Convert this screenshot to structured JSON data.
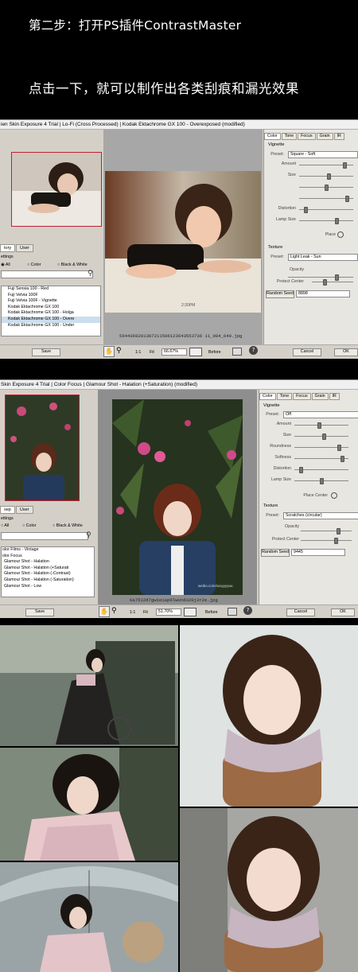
{
  "header": {
    "step_title": "第二步：打开PS插件ContrastMaster",
    "instruction": "点击一下，就可以制作出各类刮痕和漏光效果"
  },
  "window1": {
    "title": "ien Skin Exposure 4 Trial | Lo-Fi (Cross Processed) | Kodak Ektachrome GX 100 - Overexposed (modified)",
    "tabs": [
      "tory",
      "User"
    ],
    "settings_label": "ettings",
    "radios": [
      "All",
      "Color",
      "Black & White"
    ],
    "presets": [
      "Fuji Sensia 100 - Red",
      "Fuji Velvia 100F",
      "Fuji Velvia 100F - Vignette",
      "Kodak Ektachrome GX 100",
      "Kodak Ektachrome GX 100 - Holga",
      "Kodak Ektachrome GX 100 - Overe",
      "Kodak Ektachrome GX 100 - Under"
    ],
    "filename": "5644369201307211506123643553736 11_004_640.jpg",
    "right_tabs": [
      "Color",
      "Tone",
      "Focus",
      "Grain",
      "IR"
    ],
    "vignette": {
      "title": "Vignette",
      "preset_label": "Preset:",
      "preset_value": "Square - Soft",
      "sliders": [
        {
          "label": "Amount",
          "value": 0.86
        },
        {
          "label": "Size",
          "value": 0.55
        },
        {
          "label": "",
          "value": 0.5
        },
        {
          "label": "",
          "value": 0.9
        },
        {
          "label": "Distortion",
          "value": 0.1
        },
        {
          "label": "Lamp Size",
          "value": 0.7
        }
      ],
      "place_label": "Place"
    },
    "texture": {
      "title": "Texture",
      "preset_label": "Preset:",
      "preset_value": "Light Leak - Sun",
      "opacity_label": "Opacity",
      "opacity_value": 0.75,
      "protect_label": "Protect Center",
      "protect_value": 0.3,
      "random_seed_label": "Random Seed",
      "random_seed_value": "8898"
    },
    "bottom": {
      "save": "Save",
      "ratio": "1:1",
      "fit": "Fit",
      "zoom": "66.67%",
      "before": "Before",
      "cancel": "Cancel",
      "ok": "OK"
    }
  },
  "window2": {
    "title": "Skin Exposure 4 Trial | Color Focus | Glamour Shot - Halation (+Saturation) (modified)",
    "tabs": [
      "sep",
      "User"
    ],
    "settings_label": "ettings",
    "radios": [
      "All",
      "Color",
      "Black & White"
    ],
    "presets": [
      "olor Films - Vintage",
      "olor Focus",
      "Glamour Shot - Halation",
      "Glamour Shot - Halation (+Saturati",
      "Glamour Shot - Halation (-Contrast)",
      "Glamour Shot - Halation (-Saturation)",
      "Glamour Shot - Low"
    ],
    "filename": "6a7512d7gw1e1ap6lwund320j3r2e.jpg",
    "watermark": "weibo.com/xxxyyyyuu",
    "right_tabs": [
      "Color",
      "Tone",
      "Focus",
      "Grain",
      "IR"
    ],
    "vignette": {
      "title": "Vignette",
      "preset_label": "Preset:",
      "preset_value": "Off",
      "sliders": [
        {
          "label": "Amount",
          "value": 0.45
        },
        {
          "label": "Size",
          "value": 0.55
        },
        {
          "label": "Roundness",
          "value": 0.85
        },
        {
          "label": "Softness",
          "value": 0.9
        },
        {
          "label": "Distortion",
          "value": 0.1
        },
        {
          "label": "Lamp Size",
          "value": 0.5
        }
      ],
      "place_label": "Place Center"
    },
    "texture": {
      "title": "Texture",
      "preset_label": "Preset:",
      "preset_value": "Scratches (circular)",
      "opacity_label": "Opacity",
      "opacity_value": 0.75,
      "protect_label": "Protect Center",
      "protect_value": 0.7,
      "random_seed_label": "Random Seed",
      "random_seed_value": "9445"
    },
    "bottom": {
      "save": "Save",
      "ratio": "1:1",
      "fit": "Fit",
      "zoom": "51.70%",
      "before": "Before",
      "cancel": "Cancel",
      "ok": "OK"
    }
  },
  "colors": {
    "thumb_border": "#c02030",
    "panel": "#d4d0c8",
    "canvas": "#a7a7a7"
  }
}
